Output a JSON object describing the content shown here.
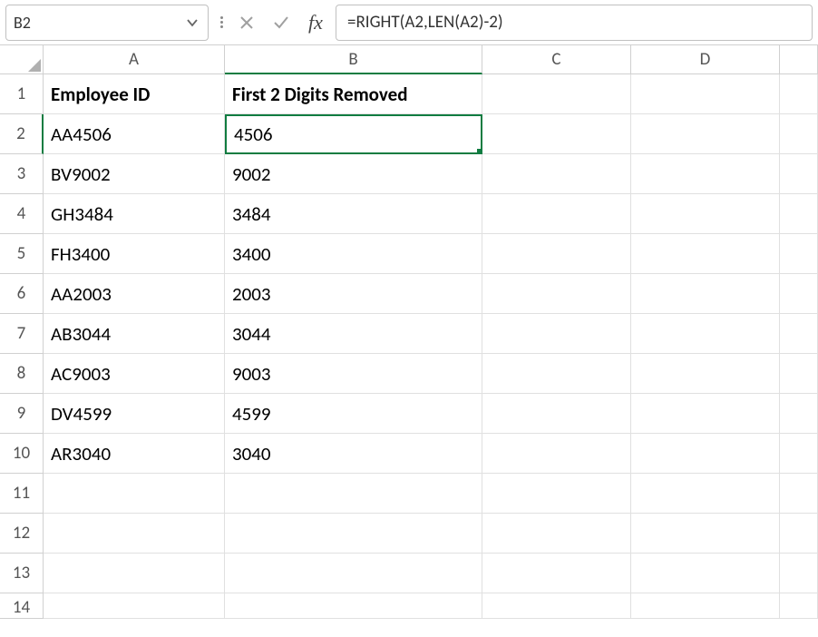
{
  "formulaBar": {
    "nameBox": "B2",
    "formula": "=RIGHT(A2,LEN(A2)-2)"
  },
  "columns": [
    "A",
    "B",
    "C",
    "D"
  ],
  "rows": [
    "1",
    "2",
    "3",
    "4",
    "5",
    "6",
    "7",
    "8",
    "9",
    "10",
    "11",
    "12",
    "13",
    "14"
  ],
  "activeColumn": "B",
  "activeRow": "2",
  "headers": {
    "A": "Employee ID",
    "B": "First 2 Digits Removed"
  },
  "data": [
    {
      "A": "AA4506",
      "B": "4506"
    },
    {
      "A": "BV9002",
      "B": "9002"
    },
    {
      "A": "GH3484",
      "B": "3484"
    },
    {
      "A": "FH3400",
      "B": "3400"
    },
    {
      "A": "AA2003",
      "B": "2003"
    },
    {
      "A": "AB3044",
      "B": "3044"
    },
    {
      "A": "AC9003",
      "B": "9003"
    },
    {
      "A": "DV4599",
      "B": "4599"
    },
    {
      "A": "AR3040",
      "B": "3040"
    }
  ],
  "selectedCell": "B2",
  "chart_data": {
    "type": "table",
    "title": "Employee ID — First 2 Digits Removed",
    "columns": [
      "Employee ID",
      "First 2 Digits Removed"
    ],
    "rows": [
      [
        "AA4506",
        "4506"
      ],
      [
        "BV9002",
        "9002"
      ],
      [
        "GH3484",
        "3484"
      ],
      [
        "FH3400",
        "3400"
      ],
      [
        "AA2003",
        "2003"
      ],
      [
        "AB3044",
        "3044"
      ],
      [
        "AC9003",
        "9003"
      ],
      [
        "DV4599",
        "4599"
      ],
      [
        "AR3040",
        "3040"
      ]
    ]
  }
}
